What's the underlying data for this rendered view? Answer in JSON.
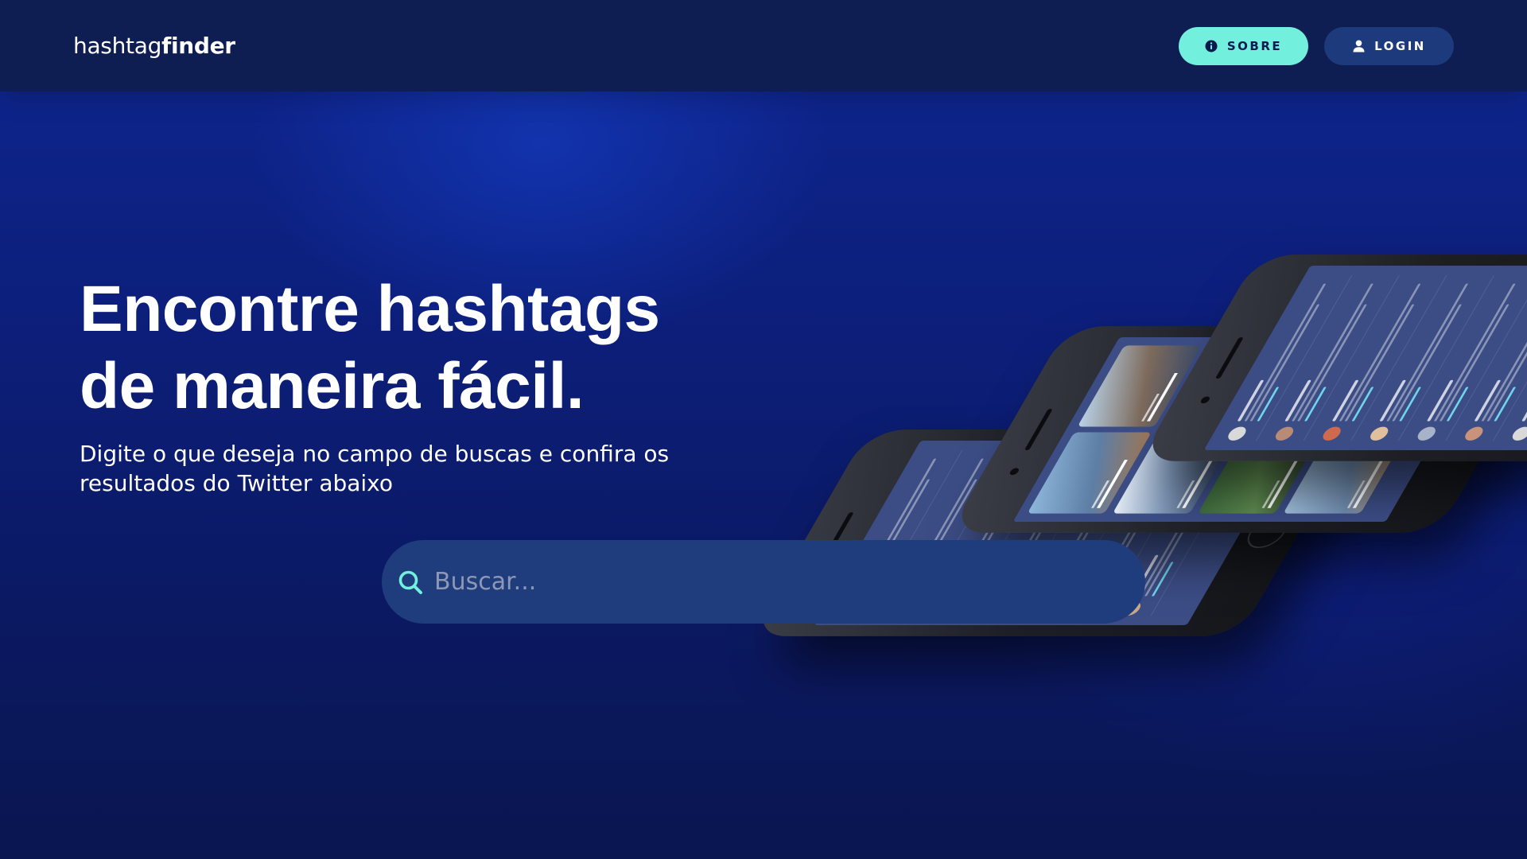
{
  "header": {
    "logo_light": "hashtag",
    "logo_bold": "finder",
    "buttons": {
      "sobre_label": "SOBRE",
      "login_label": "LOGIN"
    }
  },
  "hero": {
    "title_line1": "Encontre hashtags",
    "title_line2": "de maneira fácil.",
    "subtitle_line1": "Digite o que deseja no campo de buscas e confira os",
    "subtitle_line2": "resultados do Twitter abaixo"
  },
  "search": {
    "placeholder": "Buscar...",
    "value": ""
  },
  "colors": {
    "accent": "#72efdd",
    "navbar": "#0e1d52",
    "login_button": "#1d3a7c",
    "search_field": "#1f3d7c",
    "background": "#0c1f7c"
  },
  "icons": {
    "sobre_button": "info-icon",
    "login_button": "user-icon",
    "search": "search-icon"
  }
}
